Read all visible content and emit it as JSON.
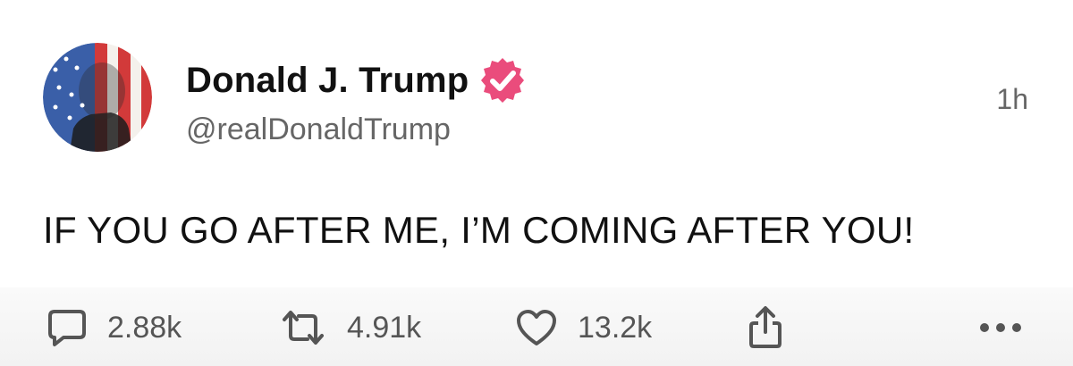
{
  "post": {
    "author": {
      "display_name": "Donald J. Trump",
      "handle": "@realDonaldTrump",
      "verified": true
    },
    "timestamp": "1h",
    "text": "IF YOU GO AFTER ME, I’M COMING AFTER YOU!",
    "actions": {
      "replies": "2.88k",
      "reposts": "4.91k",
      "likes": "13.2k"
    }
  },
  "icons": {
    "reply": "comment-bubble-icon",
    "repost": "repost-arrows-icon",
    "like": "heart-icon",
    "share": "share-icon",
    "more": "more-dots-icon",
    "verified": "verified-badge-icon"
  },
  "colors": {
    "verified_badge": "#ea4c7c",
    "text_primary": "#111111",
    "text_secondary": "#666666",
    "icon": "#555555"
  }
}
